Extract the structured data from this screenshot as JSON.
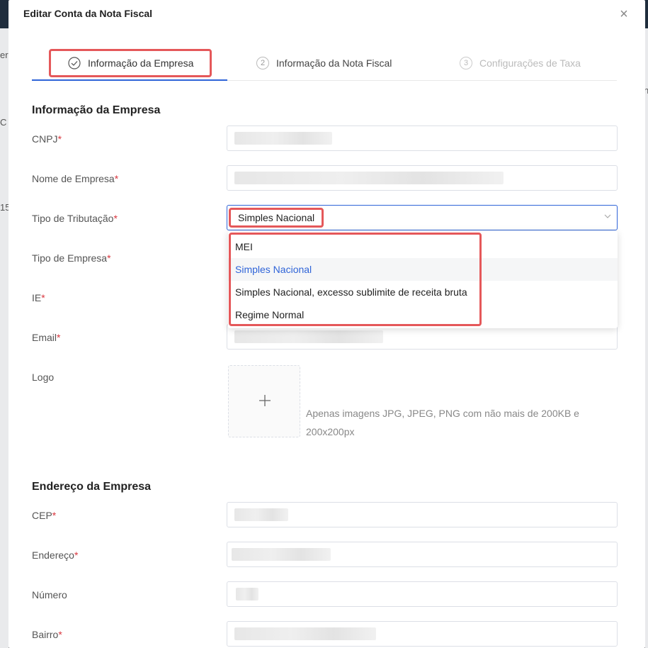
{
  "backdrop": {
    "frag1": "er",
    "frag2": "C",
    "frag3": "15",
    "frag4": "n"
  },
  "modal": {
    "title": "Editar Conta da Nota Fiscal"
  },
  "steps": [
    {
      "number": "",
      "label": "Informação da Empresa"
    },
    {
      "number": "2",
      "label": "Informação da Nota Fiscal"
    },
    {
      "number": "3",
      "label": "Configurações de Taxa"
    }
  ],
  "company": {
    "section_title": "Informação da Empresa",
    "cnpj_label": "CNPJ",
    "name_label": "Nome de Empresa",
    "tax_label": "Tipo de Tributação",
    "tax_value": "Simples Nacional",
    "type_label": "Tipo de Empresa",
    "ie_label": "IE",
    "email_label": "Email",
    "logo_label": "Logo",
    "logo_hint": "Apenas imagens JPG, JPEG, PNG com não mais de 200KB e 200x200px",
    "required_mark": "*"
  },
  "tax_options": [
    "MEI",
    "Simples Nacional",
    "Simples Nacional, excesso sublimite de receita bruta",
    "Regime Normal"
  ],
  "address": {
    "section_title": "Endereço da Empresa",
    "cep_label": "CEP",
    "street_label": "Endereço",
    "number_label": "Número",
    "district_label": "Bairro"
  },
  "colors": {
    "accent": "#2f64d8",
    "highlight": "#e5585a",
    "required": "#d9363e"
  }
}
